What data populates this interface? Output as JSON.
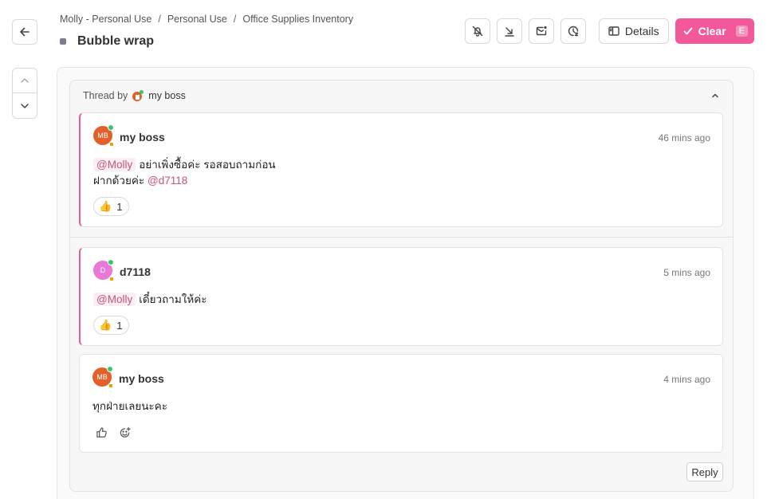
{
  "breadcrumb": [
    "Molly - Personal Use",
    "Personal Use",
    "Office Supplies Inventory"
  ],
  "breadcrumb_separator": "/",
  "title": "Bubble wrap",
  "toolbar": {
    "details_label": "Details",
    "clear_label": "Clear",
    "clear_shortcut": "E"
  },
  "thread": {
    "prefix": "Thread by",
    "author": "my boss"
  },
  "messages": [
    {
      "author": "my boss",
      "initials": "MB",
      "avatar_color": "#e2612a",
      "time": "46 mins ago",
      "mention": "@Molly",
      "line1": "อย่าเพิ่งซื้อค่ะ รอสอบถามก่อน",
      "line2": "ฝากด้วยค่ะ",
      "line2_mention": "@d7118",
      "reaction_emoji": "👍",
      "reaction_count": "1"
    },
    {
      "author": "d7118",
      "initials": "D",
      "avatar_color": "#e879d6",
      "time": "5 mins ago",
      "mention": "@Molly",
      "line1": "เดี๋ยวถามให้ค่ะ",
      "reaction_emoji": "👍",
      "reaction_count": "1"
    },
    {
      "author": "my boss",
      "initials": "MB",
      "avatar_color": "#e2612a",
      "time": "4 mins ago",
      "line1": "ทุกฝ่ายเลยนะคะ"
    }
  ],
  "reply_label": "Reply",
  "colors": {
    "accent": "#f1599a",
    "mention": "#c9527f",
    "online": "#3cc46a"
  }
}
